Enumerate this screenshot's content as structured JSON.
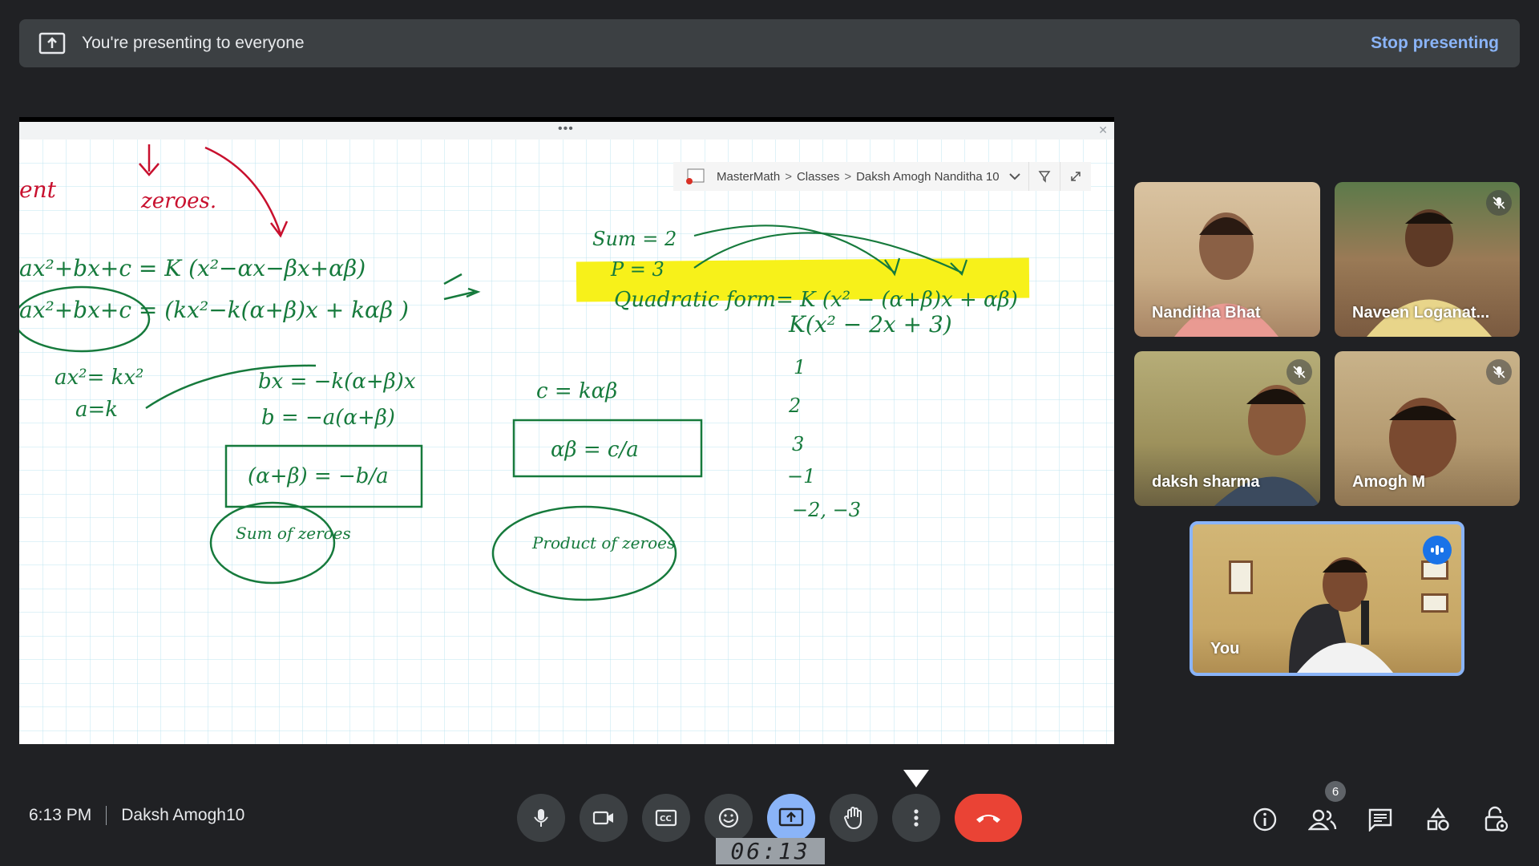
{
  "banner": {
    "text": "You're presenting to everyone",
    "stop_label": "Stop presenting"
  },
  "onenote": {
    "crumbs": [
      "MasterMath",
      "Classes",
      "Daksh Amogh Nanditha 10"
    ],
    "separator": ">"
  },
  "whiteboard": {
    "highlight_text": "Quadratic form= K (x² − (α+β)x + αβ)",
    "lines": [
      "ent",
      "zeroes.",
      "ax²+bx+c = K (x²−αx−βx+αβ)",
      "ax²+bx+c = (kx²−k(α+β)x + kαβ )",
      "ax²= kx²",
      "a=k",
      "bx = −k(α+β)x",
      "b = −a(α+β)",
      "(α+β) = −b/a",
      "Sum of zeroes",
      "Sum = 2",
      "P = 3",
      "c = kαβ",
      "αβ = c/a",
      "Product of zeroes",
      "K(x² − 2x + 3)",
      "1",
      "2",
      "3",
      "−1",
      "−2, −3"
    ]
  },
  "participants": [
    {
      "name": "Nanditha Bhat",
      "muted": false
    },
    {
      "name": "Naveen Loganat...",
      "muted": true
    },
    {
      "name": "daksh sharma",
      "muted": true
    },
    {
      "name": "Amogh M",
      "muted": true
    },
    {
      "name": "You",
      "speaking": true
    }
  ],
  "footer": {
    "time": "6:13 PM",
    "meeting_name": "Daksh Amogh10",
    "timer": "06:13",
    "people_count": "6"
  },
  "colors": {
    "ink_green": "#167a3c",
    "ink_red": "#c8102e",
    "highlight": "#f7f11a",
    "accent_blue": "#8ab4f8",
    "end_red": "#ea4335"
  },
  "icons": [
    "present-to-all-icon",
    "mic-icon",
    "camera-icon",
    "captions-icon",
    "emoji-icon",
    "present-icon",
    "raise-hand-icon",
    "more-options-icon",
    "end-call-icon",
    "info-icon",
    "people-icon",
    "chat-icon",
    "activities-icon",
    "host-controls-icon"
  ]
}
